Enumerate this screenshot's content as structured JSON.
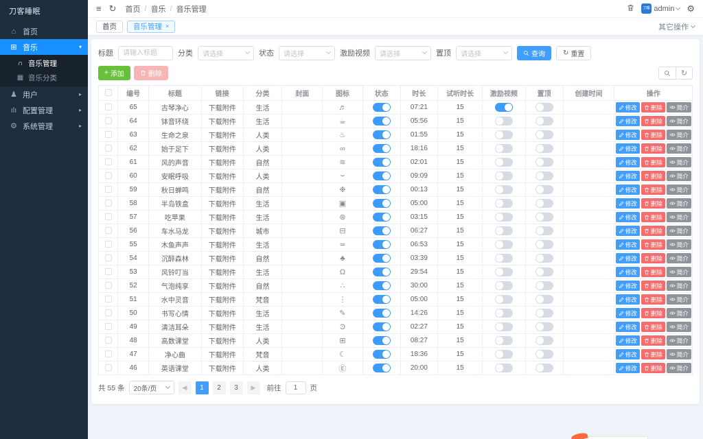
{
  "sidebar": {
    "logo": "刀客睡眠",
    "items": [
      {
        "label": "首页",
        "icon": "home-icon"
      },
      {
        "label": "音乐",
        "icon": "grid-icon",
        "expanded": true,
        "active": true,
        "children": [
          {
            "label": "音乐管理",
            "icon": "headphones-icon",
            "active": true
          },
          {
            "label": "音乐分类",
            "icon": "category-grid-icon"
          }
        ]
      },
      {
        "label": "用户",
        "icon": "user-icon"
      },
      {
        "label": "配置管理",
        "icon": "chart-icon"
      },
      {
        "label": "系统管理",
        "icon": "gear-icon"
      }
    ]
  },
  "header": {
    "breadcrumb": [
      "首页",
      "音乐",
      "音乐管理"
    ],
    "username": "admin",
    "other_actions": "其它操作"
  },
  "tabs": [
    {
      "label": "首页"
    },
    {
      "label": "音乐管理",
      "close": "×",
      "active": true
    }
  ],
  "filters": {
    "title": {
      "label": "标题",
      "placeholder": "请输入标题"
    },
    "category": {
      "label": "分类",
      "placeholder": "请选择"
    },
    "status": {
      "label": "状态",
      "placeholder": "请选择"
    },
    "reward": {
      "label": "激励视频",
      "placeholder": "请选择"
    },
    "top": {
      "label": "置顶",
      "placeholder": "请选择"
    },
    "search": "查询",
    "reset": "重置"
  },
  "toolbar": {
    "add": "添加",
    "delete": "删除"
  },
  "table": {
    "columns": [
      "编号",
      "标题",
      "链接",
      "分类",
      "封面",
      "图标",
      "状态",
      "时长",
      "试听时长",
      "激励视频",
      "置顶",
      "创建时间",
      "操作"
    ],
    "rows": [
      {
        "id": "65",
        "title": "古琴净心",
        "link": "下载附件",
        "category": "生活",
        "icon": "guqin-icon",
        "duration": "07:21",
        "trial": "15",
        "status": true,
        "reward": true,
        "top": false
      },
      {
        "id": "64",
        "title": "钵音环绕",
        "link": "下载附件",
        "category": "生活",
        "icon": "bowl-icon",
        "duration": "05:56",
        "trial": "15",
        "status": true,
        "reward": false,
        "top": false
      },
      {
        "id": "63",
        "title": "生命之泉",
        "link": "下载附件",
        "category": "人类",
        "icon": "fountain-icon",
        "duration": "01:55",
        "trial": "15",
        "status": true,
        "reward": false,
        "top": false
      },
      {
        "id": "62",
        "title": "始于足下",
        "link": "下载附件",
        "category": "人类",
        "icon": "footsteps-icon",
        "duration": "18:16",
        "trial": "15",
        "status": true,
        "reward": false,
        "top": false
      },
      {
        "id": "61",
        "title": "风的声音",
        "link": "下载附件",
        "category": "自然",
        "icon": "wind-icon",
        "duration": "02:01",
        "trial": "15",
        "status": true,
        "reward": false,
        "top": false
      },
      {
        "id": "60",
        "title": "安眠呼吸",
        "link": "下载附件",
        "category": "人类",
        "icon": "breath-icon",
        "duration": "09:09",
        "trial": "15",
        "status": true,
        "reward": false,
        "top": false
      },
      {
        "id": "59",
        "title": "秋日蝉鸣",
        "link": "下载附件",
        "category": "自然",
        "icon": "cicada-icon",
        "duration": "00:13",
        "trial": "15",
        "status": true,
        "reward": false,
        "top": false
      },
      {
        "id": "58",
        "title": "半岛铁盒",
        "link": "下载附件",
        "category": "生活",
        "icon": "box-icon",
        "duration": "05:00",
        "trial": "15",
        "status": true,
        "reward": false,
        "top": false
      },
      {
        "id": "57",
        "title": "吃苹果",
        "link": "下载附件",
        "category": "生活",
        "icon": "apple-icon",
        "duration": "03:15",
        "trial": "15",
        "status": true,
        "reward": false,
        "top": false
      },
      {
        "id": "56",
        "title": "车水马龙",
        "link": "下载附件",
        "category": "城市",
        "icon": "car-icon",
        "duration": "06:27",
        "trial": "15",
        "status": true,
        "reward": false,
        "top": false
      },
      {
        "id": "55",
        "title": "木鱼声声",
        "link": "下载附件",
        "category": "生活",
        "icon": "woodfish-icon",
        "duration": "06:53",
        "trial": "15",
        "status": true,
        "reward": false,
        "top": false
      },
      {
        "id": "54",
        "title": "沉醉森林",
        "link": "下载附件",
        "category": "自然",
        "icon": "forest-icon",
        "duration": "03:39",
        "trial": "15",
        "status": true,
        "reward": false,
        "top": false
      },
      {
        "id": "53",
        "title": "风铃叮当",
        "link": "下载附件",
        "category": "生活",
        "icon": "bell-icon",
        "duration": "29:54",
        "trial": "15",
        "status": true,
        "reward": false,
        "top": false
      },
      {
        "id": "52",
        "title": "气泡纯享",
        "link": "下载附件",
        "category": "自然",
        "icon": "bubbles-icon",
        "duration": "30:00",
        "trial": "15",
        "status": true,
        "reward": false,
        "top": false
      },
      {
        "id": "51",
        "title": "水中灵音",
        "link": "下载附件",
        "category": "梵音",
        "icon": "incense-icon",
        "duration": "05:00",
        "trial": "15",
        "status": true,
        "reward": false,
        "top": false
      },
      {
        "id": "50",
        "title": "书写心情",
        "link": "下载附件",
        "category": "生活",
        "icon": "pen-icon",
        "duration": "14:26",
        "trial": "15",
        "status": true,
        "reward": false,
        "top": false
      },
      {
        "id": "49",
        "title": "清洁耳朵",
        "link": "下载附件",
        "category": "生活",
        "icon": "ear-icon",
        "duration": "02:27",
        "trial": "15",
        "status": true,
        "reward": false,
        "top": false
      },
      {
        "id": "48",
        "title": "高数课堂",
        "link": "下载附件",
        "category": "人类",
        "icon": "blocks-icon",
        "duration": "08:27",
        "trial": "15",
        "status": true,
        "reward": false,
        "top": false
      },
      {
        "id": "47",
        "title": "净心曲",
        "link": "下载附件",
        "category": "梵音",
        "icon": "moon-icon",
        "duration": "18:36",
        "trial": "15",
        "status": true,
        "reward": false,
        "top": false
      },
      {
        "id": "46",
        "title": "英语课堂",
        "link": "下载附件",
        "category": "人类",
        "icon": "english-icon",
        "duration": "20:00",
        "trial": "15",
        "status": true,
        "reward": false,
        "top": false
      }
    ]
  },
  "row_actions": {
    "edit": "修改",
    "delete": "删除",
    "intro": "简介"
  },
  "pagination": {
    "total": "共 55 条",
    "page_size": "20条/页",
    "pages": [
      "1",
      "2",
      "3"
    ],
    "current": "1",
    "goto_label": "前往",
    "goto_value": "1",
    "page_unit": "页"
  },
  "colors": {
    "accent": "#409eff",
    "green": "#67c23a",
    "red": "#f56c6c",
    "sidebar": "#1e2d3d",
    "active_menu": "#1890ff"
  }
}
